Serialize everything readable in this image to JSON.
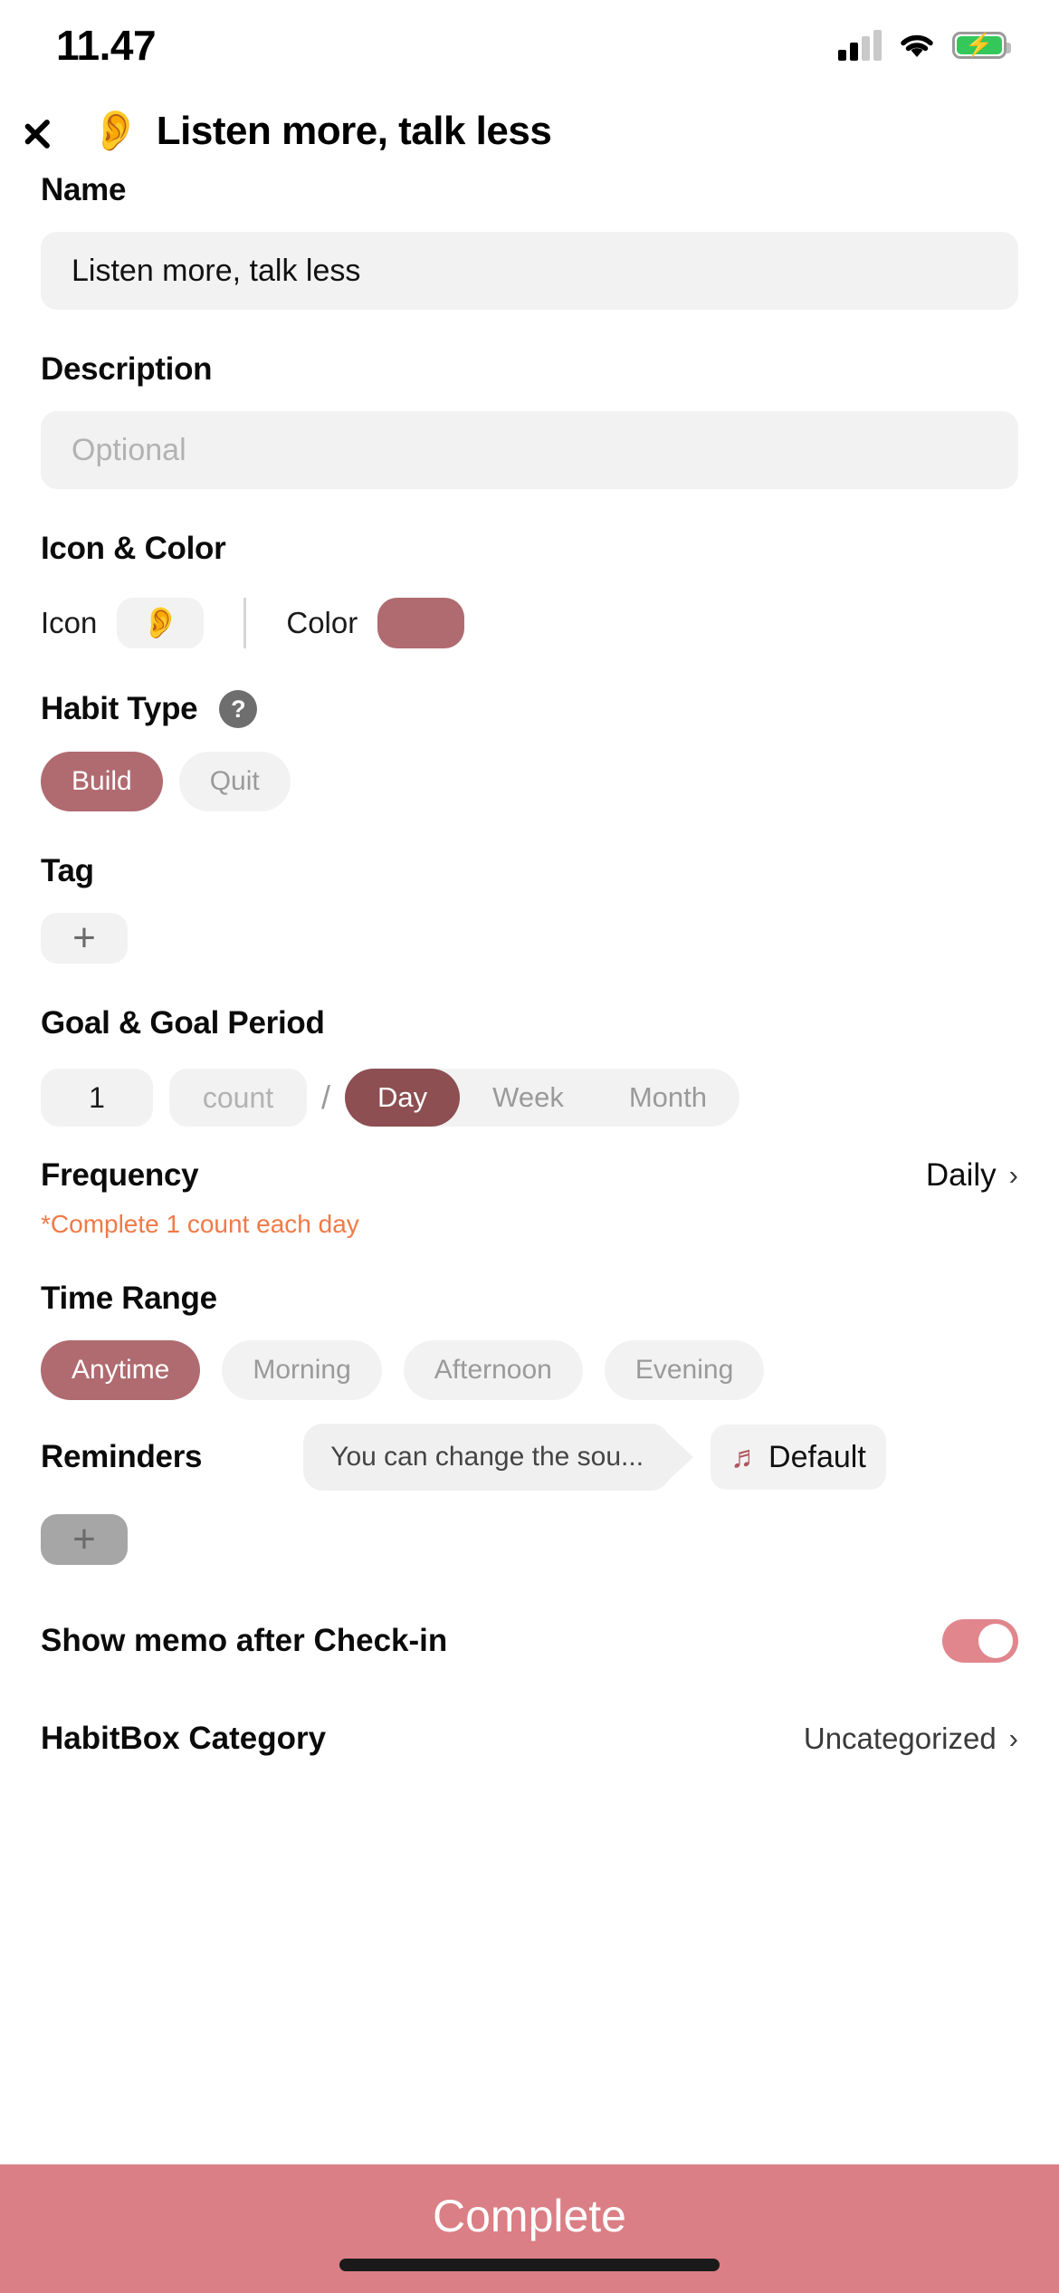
{
  "status_bar": {
    "time": "11.47",
    "moon_icon": "crescent-moon-icon",
    "signal_icon": "cellular-signal-icon",
    "wifi_icon": "wifi-icon",
    "battery_icon": "battery-charging-icon",
    "battery_color": "#34c759"
  },
  "header": {
    "back_icon": "chevron-left-icon",
    "emoji": "👂",
    "title": "Listen more, talk less"
  },
  "theme": {
    "accent": "#b06b70",
    "accent_dark": "#8d4f52",
    "bottom_bar": "#da7f85",
    "toggle_on": "#e0868c",
    "hint_orange": "#f07a47",
    "field_bg": "#f2f2f2"
  },
  "name": {
    "label": "Name",
    "value": "Listen more, talk less"
  },
  "description": {
    "label": "Description",
    "placeholder": "Optional",
    "value": ""
  },
  "icon_color": {
    "label": "Icon & Color",
    "icon_label": "Icon",
    "icon_emoji": "👂",
    "color_label": "Color",
    "color_value": "#b06b70"
  },
  "habit_type": {
    "label": "Habit Type",
    "help_icon": "question-mark-icon",
    "options": [
      "Build",
      "Quit"
    ],
    "selected": "Build"
  },
  "tag": {
    "label": "Tag",
    "add_icon": "plus-icon"
  },
  "goal": {
    "label": "Goal & Goal Period",
    "amount": "1",
    "unit_placeholder": "count",
    "separator": "/",
    "period_options": [
      "Day",
      "Week",
      "Month"
    ],
    "period_selected": "Day"
  },
  "frequency": {
    "label": "Frequency",
    "value": "Daily",
    "chevron": "›",
    "hint": "*Complete 1 count each day"
  },
  "time_range": {
    "label": "Time Range",
    "options": [
      "Anytime",
      "Morning",
      "Afternoon",
      "Evening"
    ],
    "selected": "Anytime"
  },
  "reminders": {
    "label": "Reminders",
    "tooltip": "You can change the sou...",
    "sound_icon": "music-note-icon",
    "sound_value": "Default",
    "add_icon": "plus-icon"
  },
  "memo": {
    "label": "Show memo after Check-in",
    "toggle_state": "on"
  },
  "habitbox": {
    "label": "HabitBox Category",
    "value": "Uncategorized",
    "chevron": "›"
  },
  "bottom": {
    "complete_label": "Complete"
  }
}
